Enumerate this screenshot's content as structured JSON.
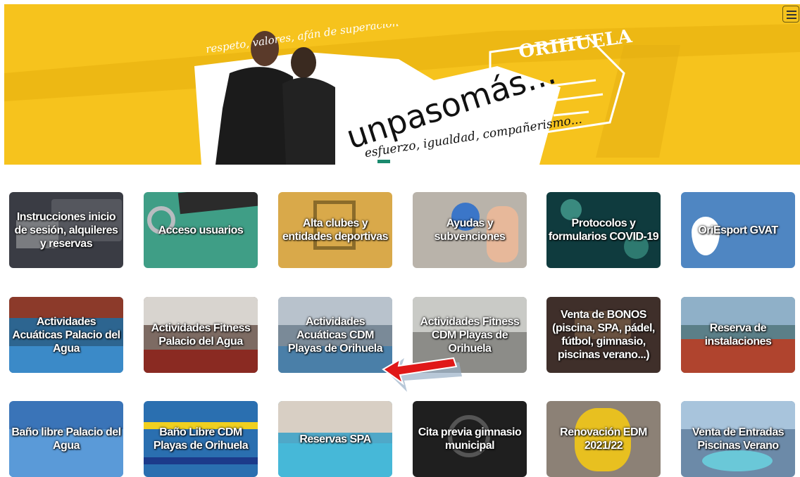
{
  "hero": {
    "slogan_main": "unpasomás...",
    "slogan_top": "respeto, valores, afán de superación",
    "slogan_bottom": "esfuerzo, igualdad, compañerismo...",
    "brand": "ORIHUELA",
    "slides": 3,
    "active_slide": 1
  },
  "menu": {
    "icon": "hamburger-icon"
  },
  "tiles": [
    {
      "label": "Instrucciones inicio de sesión, alquileres y reservas",
      "color": "#3a3c44"
    },
    {
      "label": "Acceso usuarios",
      "color": "#3f9e86"
    },
    {
      "label": "Alta clubes y entidades deportivas",
      "color": "#d9a94a"
    },
    {
      "label": "Ayudas y subvenciones",
      "color": "#b9b3aa"
    },
    {
      "label": "Protocolos y formularios COVID-19",
      "color": "#0f3b3e"
    },
    {
      "label": "OriEsport GVAT",
      "color": "#4f86c2"
    },
    {
      "label": "Actividades Acuáticas Palacio del Agua",
      "color": "#2d6590"
    },
    {
      "label": "Actividades Fitness Palacio del Agua",
      "color": "#7d6b63"
    },
    {
      "label": "Actividades Acuáticas CDM Playas de Orihuela",
      "color": "#7a8a98"
    },
    {
      "label": "Actividades Fitness CDM Playas de Orihuela",
      "color": "#8c8c88"
    },
    {
      "label": "Venta de BONOS (piscina, SPA, pádel, fútbol, gimnasio, piscinas verano...)",
      "color": "#3f2f2a"
    },
    {
      "label": "Reserva de instalaciones",
      "color": "#5b7f88"
    },
    {
      "label": "Baño libre Palacio del Agua",
      "color": "#3a74b8"
    },
    {
      "label": "Baño Libre CDM Playas de Orihuela",
      "color": "#2a6fb0"
    },
    {
      "label": "Reservas SPA",
      "color": "#4fa8c8"
    },
    {
      "label": "Cita previa gimnasio municipal",
      "color": "#1f1f1f"
    },
    {
      "label": "Renovación EDM 2021/22",
      "color": "#8c8176"
    },
    {
      "label": "Venta de Entradas Piscinas Verano",
      "color": "#6c8aa8"
    }
  ]
}
